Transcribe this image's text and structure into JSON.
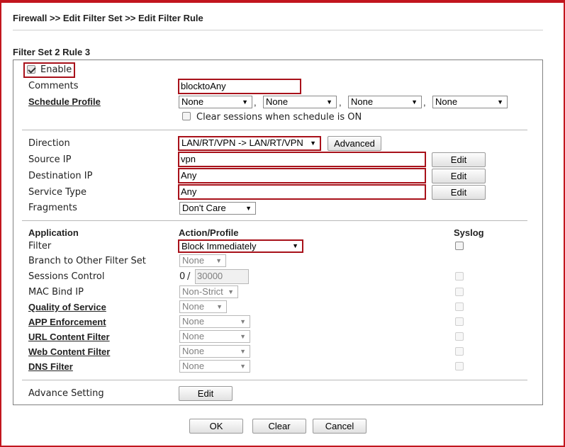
{
  "breadcrumb": "Firewall >> Edit Filter Set >> Edit Filter Rule",
  "section_title": "Filter Set 2 Rule 3",
  "enable": {
    "label": "Enable",
    "checked": true
  },
  "comments": {
    "label": "Comments",
    "value": "blocktoAny"
  },
  "schedule": {
    "label": "Schedule Profile",
    "profiles": [
      "None",
      "None",
      "None",
      "None"
    ],
    "separator": ",",
    "clear_sessions_label": "Clear sessions when schedule is ON",
    "clear_sessions_checked": false
  },
  "direction": {
    "label": "Direction",
    "value": "LAN/RT/VPN -> LAN/RT/VPN",
    "advanced_label": "Advanced"
  },
  "source_ip": {
    "label": "Source IP",
    "value": "vpn",
    "edit_label": "Edit"
  },
  "destination_ip": {
    "label": "Destination IP",
    "value": "Any",
    "edit_label": "Edit"
  },
  "service_type": {
    "label": "Service Type",
    "value": "Any",
    "edit_label": "Edit"
  },
  "fragments": {
    "label": "Fragments",
    "value": "Don't Care"
  },
  "table_headers": {
    "application": "Application",
    "action_profile": "Action/Profile",
    "syslog": "Syslog"
  },
  "filter": {
    "label": "Filter",
    "value": "Block Immediately",
    "syslog_checked": false
  },
  "branch": {
    "label": "Branch to Other Filter Set",
    "value": "None"
  },
  "sessions_control": {
    "label": "Sessions Control",
    "current": "0",
    "slash": "/",
    "max": "30000"
  },
  "mac_bind": {
    "label": "MAC Bind IP",
    "value": "Non-Strict"
  },
  "qos": {
    "label": "Quality of Service",
    "value": "None"
  },
  "app_enforcement": {
    "label": "APP Enforcement",
    "value": "None"
  },
  "url_filter": {
    "label": "URL Content Filter",
    "value": "None"
  },
  "web_filter": {
    "label": "Web Content Filter",
    "value": "None"
  },
  "dns_filter": {
    "label": "DNS Filter",
    "value": "None"
  },
  "advance_setting": {
    "label": "Advance Setting",
    "edit_label": "Edit"
  },
  "footer": {
    "ok": "OK",
    "clear": "Clear",
    "cancel": "Cancel"
  },
  "colors": {
    "frame": "#c2161e",
    "highlight": "#a8111a"
  }
}
